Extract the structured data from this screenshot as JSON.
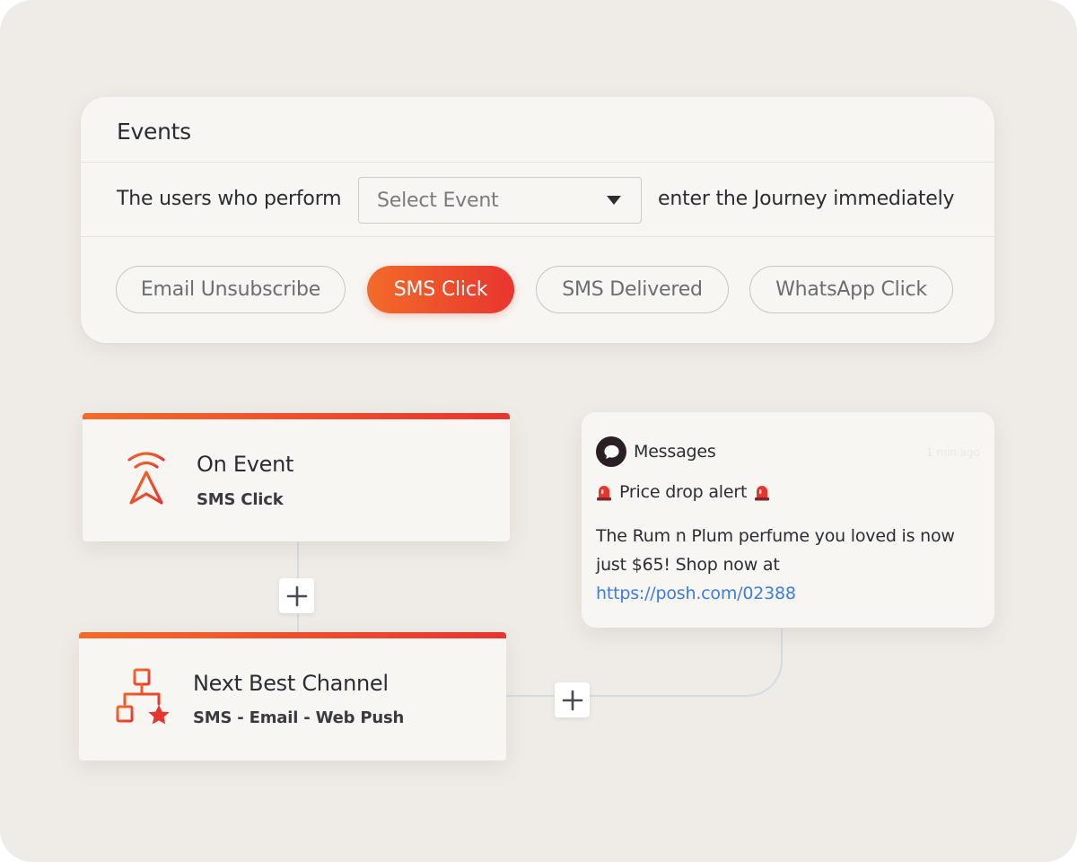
{
  "events_panel": {
    "title": "Events",
    "sentence_prefix": "The users who perform",
    "sentence_suffix": "enter the Journey immediately",
    "select": {
      "placeholder": "Select Event"
    },
    "chips": [
      {
        "label": "Email Unsubscribe",
        "selected": false
      },
      {
        "label": "SMS Click",
        "selected": true
      },
      {
        "label": "SMS Delivered",
        "selected": false
      },
      {
        "label": "WhatsApp Click",
        "selected": false
      }
    ]
  },
  "journey": {
    "trigger_node": {
      "title": "On Event",
      "subtitle": "SMS Click",
      "icon": "broadcast-navigation-icon"
    },
    "channel_node": {
      "title": "Next Best Channel",
      "subtitle": "SMS - Email - Web Push",
      "icon": "hierarchy-star-icon"
    },
    "add_step_icon": "plus-icon"
  },
  "message_preview": {
    "app_name": "Messages",
    "time": "1 min ago",
    "headline": "Price drop alert",
    "headline_emoji": "siren-icon",
    "body": "The Rum n Plum perfume you loved is now just $65! Shop now at",
    "link": "https://posh.com/02388"
  },
  "colors": {
    "accent_start": "#f36b2a",
    "accent_end": "#e8352f",
    "background": "#efebe6",
    "card": "#f8f6f3",
    "link": "#3b7ddd"
  }
}
